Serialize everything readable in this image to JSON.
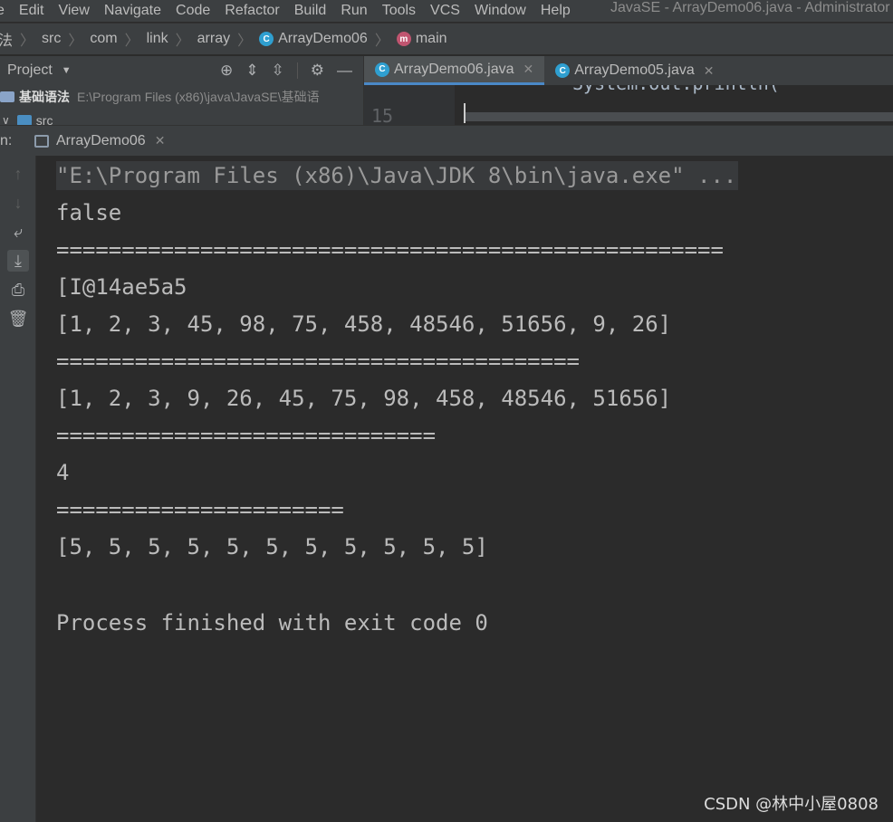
{
  "menubar": {
    "items": [
      "e",
      "Edit",
      "View",
      "Navigate",
      "Code",
      "Refactor",
      "Build",
      "Run",
      "Tools",
      "VCS",
      "Window",
      "Help"
    ],
    "window_title": "JavaSE - ArrayDemo06.java - Administrator"
  },
  "breadcrumb": {
    "items": [
      "法",
      "src",
      "com",
      "link",
      "array",
      "ArrayDemo06",
      "main"
    ]
  },
  "project": {
    "title": "Project",
    "root_name": "基础语法",
    "root_path": "E:\\Program Files (x86)\\java\\JavaSE\\基础语",
    "child": "src"
  },
  "editor": {
    "tabs": [
      "ArrayDemo06.java",
      "ArrayDemo05.java"
    ],
    "line_number": "15",
    "partial_code": "System.out.println("
  },
  "run": {
    "label": "n:",
    "tab": "ArrayDemo06"
  },
  "console": {
    "lines": [
      "\"E:\\Program Files (x86)\\Java\\JDK 8\\bin\\java.exe\" ...",
      "false",
      "===================================================",
      "[I@14ae5a5",
      "[1, 2, 3, 45, 98, 75, 458, 48546, 51656, 9, 26]",
      "========================================",
      "[1, 2, 3, 9, 26, 45, 75, 98, 458, 48546, 51656]",
      "=============================",
      "4",
      "======================",
      "[5, 5, 5, 5, 5, 5, 5, 5, 5, 5, 5]",
      "",
      "Process finished with exit code 0"
    ]
  },
  "watermark": "CSDN @林中小屋0808",
  "colors": {
    "background": "#2b2b2b",
    "panel": "#3c3f41",
    "accent": "#4a88c7",
    "text": "#bbbbbb"
  }
}
